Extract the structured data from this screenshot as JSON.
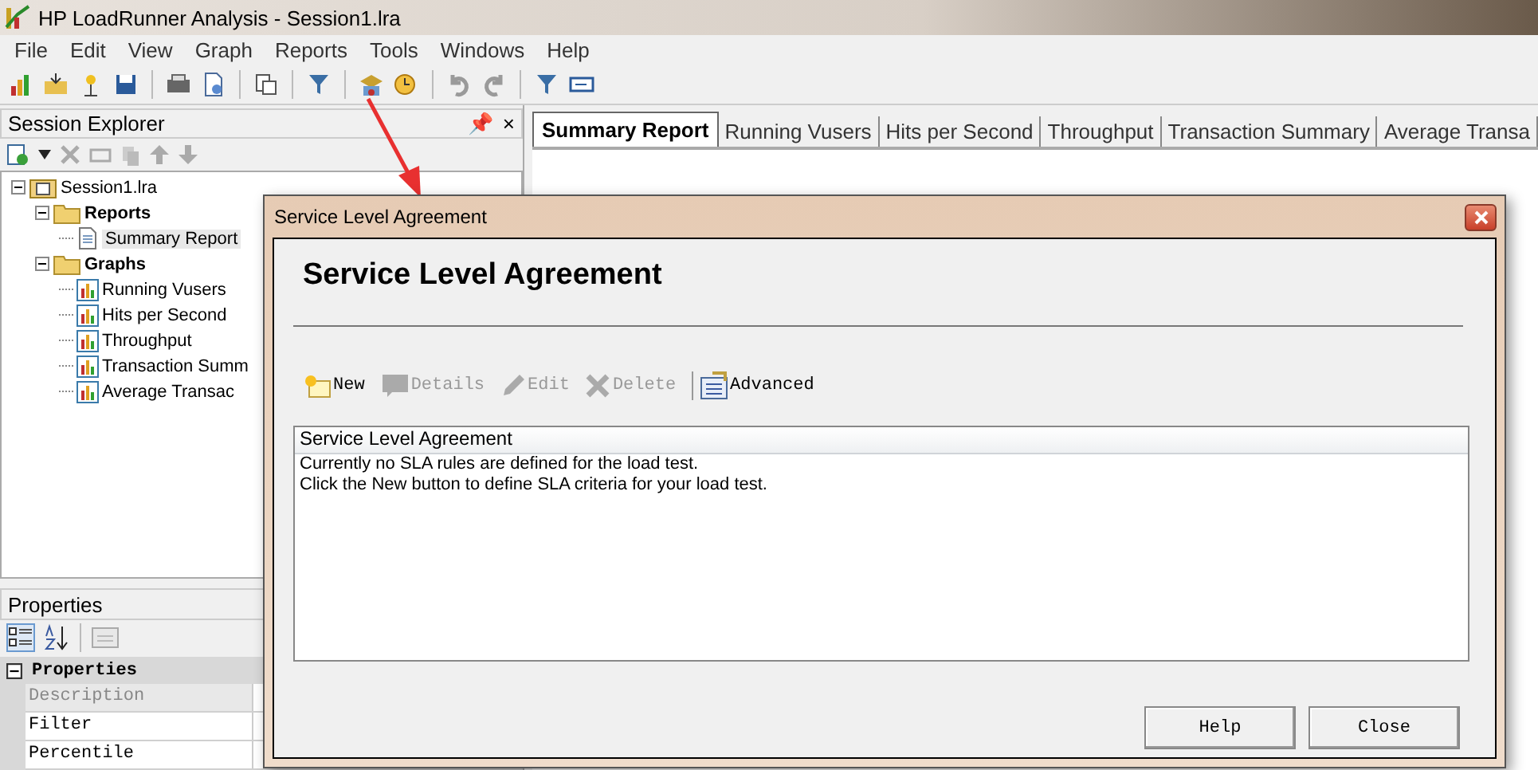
{
  "window": {
    "title": "HP LoadRunner Analysis - Session1.lra"
  },
  "menu": [
    "File",
    "Edit",
    "View",
    "Graph",
    "Reports",
    "Tools",
    "Windows",
    "Help"
  ],
  "session_explorer": {
    "title": "Session Explorer",
    "pin": "📌",
    "close": "×",
    "tree": [
      {
        "label": "Session1.lra",
        "kind": "session",
        "bold": false,
        "expanded": true,
        "selected": false,
        "children": [
          {
            "label": "Reports",
            "kind": "folder",
            "bold": true,
            "expanded": true,
            "selected": false,
            "children": [
              {
                "label": "Summary Report",
                "kind": "report",
                "bold": false,
                "selected": true
              }
            ]
          },
          {
            "label": "Graphs",
            "kind": "folder",
            "bold": true,
            "expanded": true,
            "selected": false,
            "children": [
              {
                "label": "Running Vusers",
                "kind": "graph",
                "bold": false,
                "selected": false
              },
              {
                "label": "Hits per Second",
                "kind": "graph",
                "bold": false,
                "selected": false
              },
              {
                "label": "Throughput",
                "kind": "graph",
                "bold": false,
                "selected": false
              },
              {
                "label": "Transaction Summ",
                "kind": "graph",
                "bold": false,
                "selected": false
              },
              {
                "label": "Average Transac",
                "kind": "graph",
                "bold": false,
                "selected": false
              }
            ]
          }
        ]
      }
    ]
  },
  "properties": {
    "title": "Properties",
    "category": {
      "label": "Properties",
      "expanded": true
    },
    "rows": [
      {
        "label": "Description",
        "disabled": true
      },
      {
        "label": "Filter",
        "disabled": false
      },
      {
        "label": "Percentile",
        "disabled": false
      }
    ]
  },
  "tabs": [
    {
      "label": "Summary Report",
      "selected": true
    },
    {
      "label": "Running Vusers",
      "selected": false
    },
    {
      "label": "Hits per Second",
      "selected": false
    },
    {
      "label": "Throughput",
      "selected": false
    },
    {
      "label": "Transaction Summary",
      "selected": false
    },
    {
      "label": "Average Transa",
      "selected": false
    }
  ],
  "dialog": {
    "title": "Service Level Agreement",
    "heading": "Service Level Agreement",
    "actions": [
      {
        "label": "New",
        "kind": "new",
        "disabled": false
      },
      {
        "label": "Details",
        "kind": "details",
        "disabled": true
      },
      {
        "label": "Edit",
        "kind": "edit",
        "disabled": true
      },
      {
        "label": "Delete",
        "kind": "delete",
        "disabled": true
      },
      {
        "label": "Advanced",
        "kind": "advanced",
        "disabled": false
      }
    ],
    "list": {
      "header": "Service Level Agreement",
      "lines": [
        "Currently no SLA rules are defined for the load test.",
        "Click the New button to define SLA criteria for your load test."
      ]
    },
    "buttons": [
      "Help",
      "Close"
    ]
  }
}
